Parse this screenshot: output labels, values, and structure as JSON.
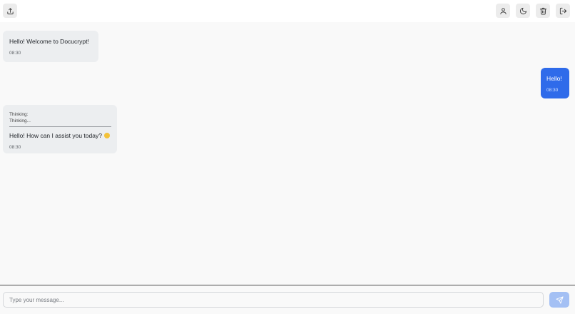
{
  "header": {
    "left_icons": [
      "upload-icon"
    ],
    "right_icons": [
      "user-icon",
      "moon-icon",
      "trash-icon",
      "logout-icon"
    ]
  },
  "messages": [
    {
      "role": "bot",
      "text": "Hello! Welcome to Docucrypt!",
      "time": "08:30"
    },
    {
      "role": "user",
      "text": "Hello!",
      "time": "08:30"
    },
    {
      "role": "bot",
      "thinking_label": "Thinking:",
      "thinking_text": "Thinking...",
      "text": "Hello! How can I assist you today?",
      "emoji": "smiling-face",
      "time": "08:30"
    }
  ],
  "composer": {
    "placeholder": "Type your message...",
    "value": "",
    "send_icon": "send-icon"
  },
  "colors": {
    "user_bubble": "#2f6bea",
    "bot_bubble": "#eceef0",
    "send_button": "#a4c0f4"
  }
}
